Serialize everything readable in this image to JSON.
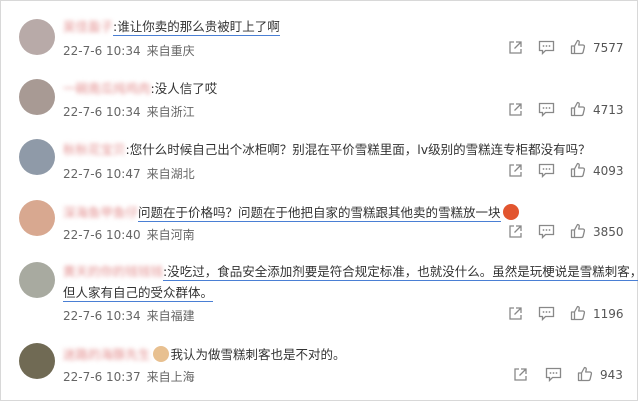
{
  "comments": [
    {
      "username": "吴佳盈子",
      "text": ":谁让你卖的那么贵被盯上了啊",
      "date": "22-7-6 10:34",
      "location": "来自重庆",
      "likes": "7577",
      "avatar_color": "#b8aaa8"
    },
    {
      "username": "一碗南瓜炖鸡肉",
      "text": ":没人信了哎",
      "date": "22-7-6 10:34",
      "location": "来自浙江",
      "likes": "4713",
      "avatar_color": "#a89a94"
    },
    {
      "username": "秋秋花宝贝",
      "text": ":您什么时候自己出个冰柜啊？别混在平价雪糕里面，lv级别的雪糕连专柜都没有吗？",
      "date": "22-7-6 10:47",
      "location": "来自湖北",
      "likes": "4093",
      "avatar_color": "#8f9aa8"
    },
    {
      "username": "深海鱼甲鱼仔",
      "text": "问题在于价格吗？问题在于他把自家的雪糕跟其他卖的雪糕放一块",
      "date": "22-7-6 10:40",
      "location": "来自河南",
      "likes": "3850",
      "avatar_color": "#d8a890"
    },
    {
      "username": "黄天的你的钱钱钱",
      "text_line1": ":没吃过，食品安全添加剂要是符合规定标准，也就没什么。虽然是玩梗说是雪糕刺客，",
      "text_line2": "但人家有自己的受众群体。",
      "date": "22-7-6 10:34",
      "location": "来自福建",
      "likes": "1196",
      "avatar_color": "#a8aaa0"
    },
    {
      "username": "迷路的海豚先生",
      "text": "我认为做雪糕刺客也是不对的。",
      "date": "22-7-6 10:37",
      "location": "来自上海",
      "likes": "943",
      "avatar_color": "#706a54"
    }
  ],
  "icons": {
    "share": "share-icon",
    "comment": "comment-icon",
    "like": "thumbs-up-icon"
  },
  "colors": {
    "underline": "#4a7fd4",
    "username": "#e38f8f"
  }
}
